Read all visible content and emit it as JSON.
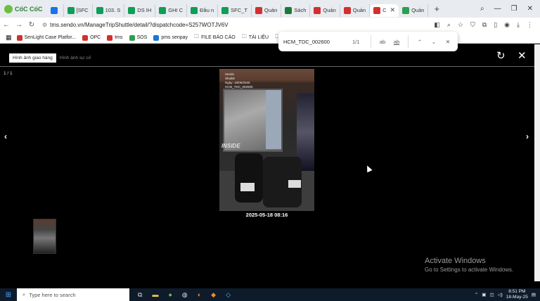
{
  "browser": {
    "brand": "CốC CốC",
    "tabs": [
      {
        "label": "",
        "color": "#1a73e8"
      },
      {
        "label": "[SFC",
        "color": "#0f9d58"
      },
      {
        "label": "103. S",
        "color": "#0f9d58"
      },
      {
        "label": "DS IH",
        "color": "#0f9d58"
      },
      {
        "label": "GHI C",
        "color": "#0f9d58"
      },
      {
        "label": "Đầu n",
        "color": "#0f9d58"
      },
      {
        "label": "SFC_T",
        "color": "#0f9d58"
      },
      {
        "label": "Quản",
        "color": "#d32f2f"
      },
      {
        "label": "Sách",
        "color": "#1b7a3a"
      },
      {
        "label": "Quản",
        "color": "#d32f2f"
      },
      {
        "label": "Quản",
        "color": "#d32f2f"
      },
      {
        "label": "C",
        "color": "#d32f2f",
        "active": true
      },
      {
        "label": "Quản",
        "color": "#2e9e4f"
      }
    ],
    "new_tab": "+",
    "url": "tms.sendo.vn/ManageTripShuttle/detail/?dispatchcode=S257WOTJV6V",
    "bookmarks": [
      {
        "label": "SenLight Case Platfor...",
        "color": "#d32f2f"
      },
      {
        "label": "OPC",
        "color": "#d32f2f"
      },
      {
        "label": "tms",
        "color": "#d32f2f"
      },
      {
        "label": "SOS",
        "color": "#2e9e4f"
      },
      {
        "label": "pms senpay",
        "color": "#1976d2"
      },
      {
        "label": "FILE BÁO CÁO",
        "color": "folder"
      },
      {
        "label": "TÀI LIỆU",
        "color": "folder"
      },
      {
        "label": "FILE C",
        "color": "folder"
      }
    ]
  },
  "find": {
    "term": "HCM_TDC_002600",
    "count": "1/1",
    "opt1": "ab",
    "opt2": "ab"
  },
  "viewer": {
    "tabs": [
      "Hình ảnh giao hàng",
      "Hình ảnh sự cố"
    ],
    "counter": "1 / 1",
    "caption": "2025-05-18 08:16",
    "photo_watermark": "Sendo\nShuttle\nNgày: 18/05/2025\nHCM_TDC_002600",
    "photo_sign": "INSIDE"
  },
  "windows_notice": {
    "title": "Activate Windows",
    "subtitle": "Go to Settings to activate Windows."
  },
  "taskbar": {
    "search_placeholder": "Type here to search",
    "time": "8:51 PM",
    "date": "18-May-25"
  }
}
